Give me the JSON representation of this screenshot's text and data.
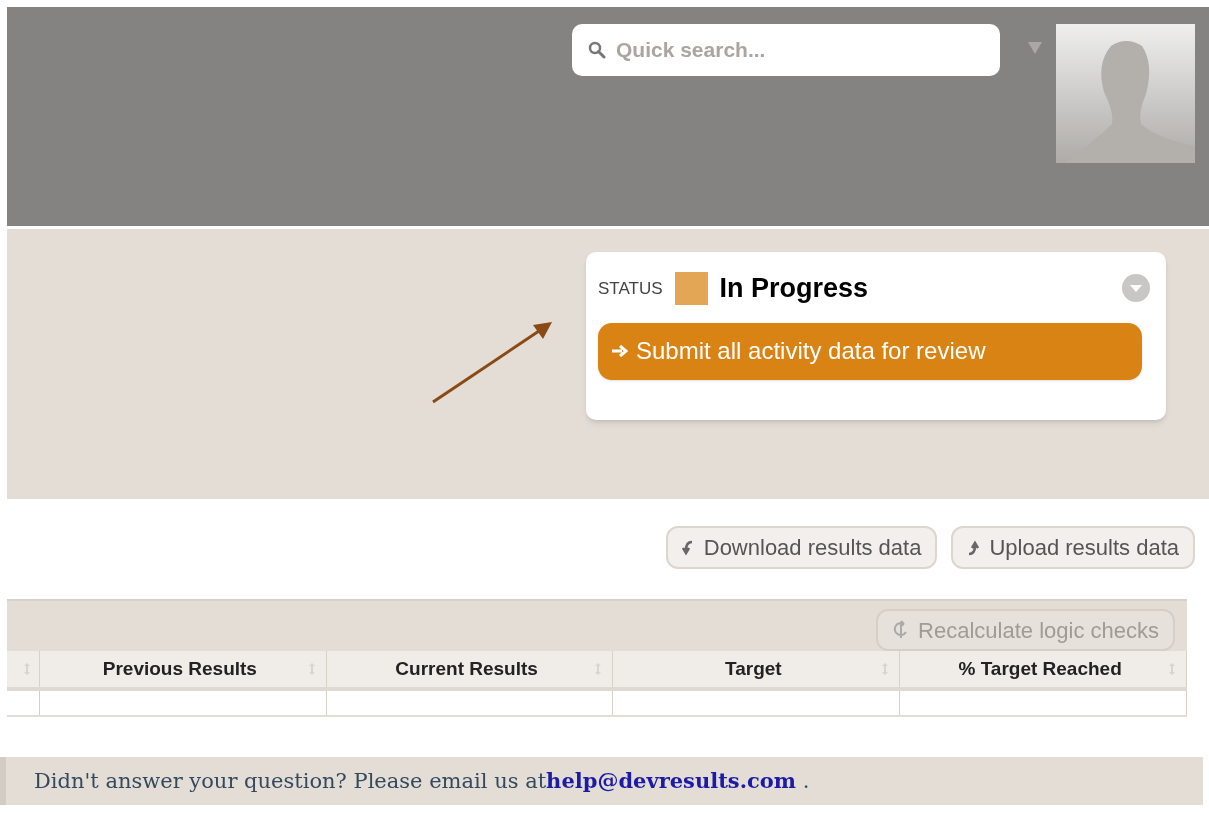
{
  "header": {
    "search": {
      "placeholder": "Quick search..."
    }
  },
  "status_card": {
    "label": "STATUS",
    "value": "In Progress",
    "color": "#e3a654",
    "submit_button": "Submit all activity data for review"
  },
  "actions": [
    "Download results data",
    "Upload results data"
  ],
  "table": {
    "recalculate_button": "Recalculate logic checks",
    "columns": [
      "Previous Results",
      "Current Results",
      "Target",
      "% Target Reached"
    ]
  },
  "footer": {
    "text": "Didn't answer your question? Please email us at",
    "link": "help@devresults.com",
    "after": " ."
  }
}
